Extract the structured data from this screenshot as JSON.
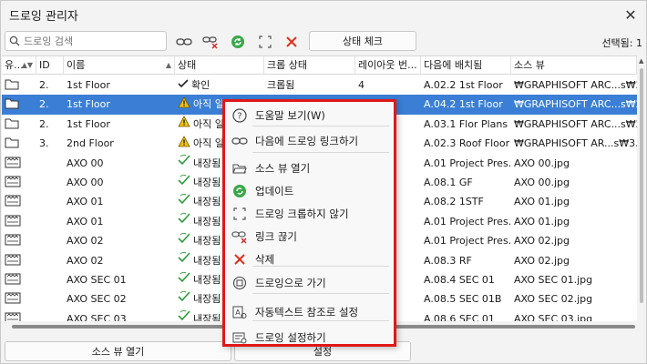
{
  "window": {
    "title": "드로잉 관리자"
  },
  "toolbar": {
    "search_placeholder": "드로잉 검색",
    "status_check_label": "상태 체크",
    "selected_label": "선택됨: 1"
  },
  "table": {
    "columns": [
      "유...",
      "ID",
      "이름",
      "상태",
      "크롭 상태",
      "레이아웃 번...",
      "다음에 배치됨",
      "소스 뷰"
    ],
    "rows": [
      {
        "type": "folder",
        "id": "2.",
        "name": "1st Floor",
        "status": "확인",
        "status_icon": "check",
        "crop": "크롭됨",
        "layout": "4",
        "placed": "A.02.2 1st Floor",
        "source": "₩GRAPHISOFT ARC...s₩2.",
        "sel": "none"
      },
      {
        "type": "folder",
        "id": "2.",
        "name": "1st Floor",
        "status": "아직 일치 않음",
        "status_icon": "warning",
        "crop": "크롭됨",
        "layout": "3",
        "placed": "A.04.2 1st Floor",
        "source": "₩GRAPHISOFT ARC...s₩2.",
        "sel": "primary"
      },
      {
        "type": "folder",
        "id": "2.",
        "name": "1st Floor",
        "status": "아직 일치",
        "status_icon": "warning",
        "crop": "",
        "layout": "",
        "placed": "A.03.1 Flor Plans",
        "source": "₩GRAPHISOFT ARC...s₩2.",
        "sel": "none"
      },
      {
        "type": "folder",
        "id": "3.",
        "name": "2nd Floor",
        "status": "아직 일치",
        "status_icon": "warning",
        "crop": "",
        "layout": "",
        "placed": "A.02.3 Roof Floor",
        "source": "₩GRAPHISOFT AR...s₩3. 2",
        "sel": "none"
      },
      {
        "type": "image",
        "id": "",
        "name": "AXO 00",
        "status": "내장됨",
        "status_icon": "embed",
        "crop": "",
        "layout": "",
        "placed": "A.01 Project Pres...",
        "source": "AXO 00.jpg",
        "sel": "none"
      },
      {
        "type": "image",
        "id": "",
        "name": "AXO 00",
        "status": "내장됨",
        "status_icon": "embed",
        "crop": "",
        "layout": "",
        "placed": "A.08.1 GF",
        "source": "AXO 00.jpg",
        "sel": "none"
      },
      {
        "type": "image",
        "id": "",
        "name": "AXO 01",
        "status": "내장됨",
        "status_icon": "embed",
        "crop": "",
        "layout": "",
        "placed": "A.08.2 1STF",
        "source": "AXO 01.jpg",
        "sel": "none"
      },
      {
        "type": "image",
        "id": "",
        "name": "AXO 01",
        "status": "내장됨",
        "status_icon": "embed",
        "crop": "",
        "layout": "",
        "placed": "A.01 Project Pres...",
        "source": "AXO 01.jpg",
        "sel": "none"
      },
      {
        "type": "image",
        "id": "",
        "name": "AXO 02",
        "status": "내장됨",
        "status_icon": "embed",
        "crop": "",
        "layout": "",
        "placed": "A.01 Project Pres...",
        "source": "AXO 02.jpg",
        "sel": "none"
      },
      {
        "type": "image",
        "id": "",
        "name": "AXO 02",
        "status": "내장됨",
        "status_icon": "embed",
        "crop": "",
        "layout": "",
        "placed": "A.08.3 RF",
        "source": "AXO 02.jpg",
        "sel": "none"
      },
      {
        "type": "image",
        "id": "",
        "name": "AXO SEC 01",
        "status": "내장됨",
        "status_icon": "embed",
        "crop": "",
        "layout": "",
        "placed": "A.08.4 SEC 01",
        "source": "AXO SEC 01.jpg",
        "sel": "none"
      },
      {
        "type": "image",
        "id": "",
        "name": "AXO SEC 02",
        "status": "내장됨",
        "status_icon": "embed",
        "crop": "",
        "layout": "",
        "placed": "A.08.5 SEC 01B",
        "source": "AXO SEC 02.jpg",
        "sel": "none"
      },
      {
        "type": "image",
        "id": "",
        "name": "AXO SEC 03",
        "status": "내장됨",
        "status_icon": "embed",
        "crop": "",
        "layout": "",
        "placed": "A.08.6 SEC 01",
        "source": "AXO SEC 03.jpg",
        "sel": "none"
      }
    ]
  },
  "bottom": {
    "open_source_view": "소스 뷰 열기",
    "settings": "설정"
  },
  "context_menu": {
    "items": [
      {
        "label": "도움말 보기(W)",
        "icon": "help-icon"
      },
      {
        "label": "다음에 드로잉 링크하기",
        "icon": "link-icon"
      },
      {
        "label": "소스 뷰 열기",
        "icon": "open-folder-icon"
      },
      {
        "label": "업데이트",
        "icon": "refresh-icon"
      },
      {
        "label": "드로잉 크롭하지 않기",
        "icon": "uncrop-icon"
      },
      {
        "label": "링크 끊기",
        "icon": "unlink-icon"
      },
      {
        "label": "삭제",
        "icon": "delete-icon"
      },
      {
        "label": "드로잉으로 가기",
        "icon": "goto-drawing-icon"
      },
      {
        "label": "자동텍스트 참조로 설정",
        "icon": "autotext-icon"
      },
      {
        "label": "드로잉 설정하기",
        "icon": "drawing-settings-icon"
      }
    ]
  },
  "colors": {
    "selection": "#3a7fd5",
    "highlight_border": "#e01818",
    "ok_green": "#2d9a3a",
    "warning_yellow": "#f4c20d"
  }
}
